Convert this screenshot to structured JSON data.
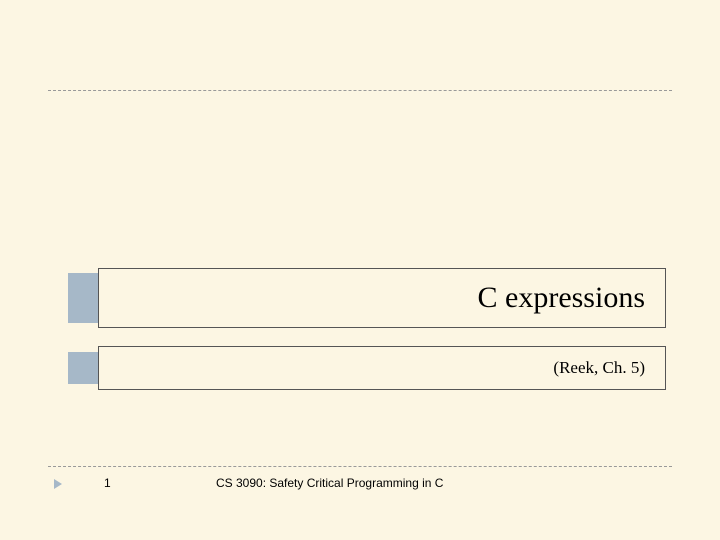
{
  "title": "C expressions",
  "subtitle": "(Reek, Ch. 5)",
  "footer": {
    "page": "1",
    "course": "CS 3090: Safety Critical Programming in C"
  }
}
